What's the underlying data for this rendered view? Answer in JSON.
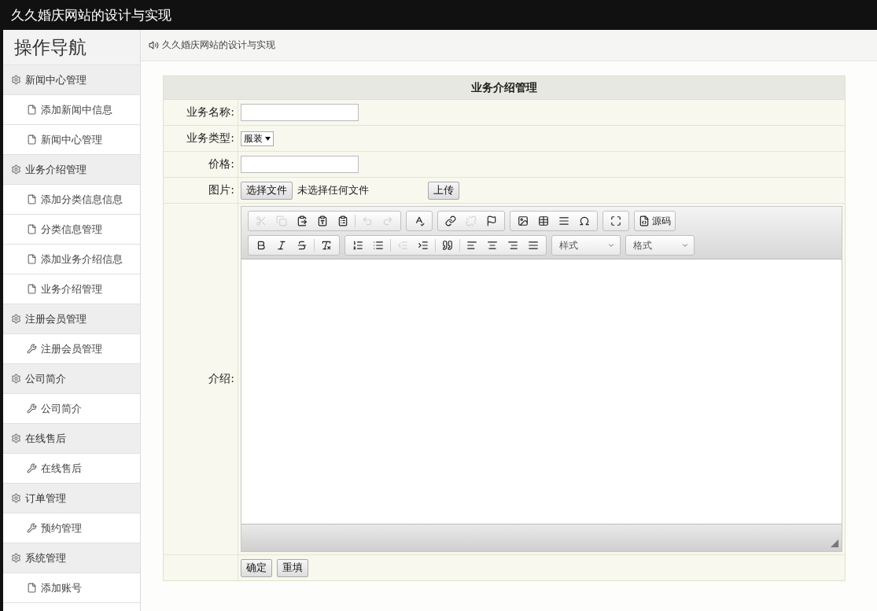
{
  "header": {
    "title": "久久婚庆网站的设计与实现"
  },
  "sidebar": {
    "title": "操作导航",
    "groups": [
      {
        "label": "新闻中心管理",
        "children": [
          {
            "label": "添加新闻中信息",
            "kind": "page"
          },
          {
            "label": "新闻中心管理",
            "kind": "page"
          }
        ]
      },
      {
        "label": "业务介绍管理",
        "children": [
          {
            "label": "添加分类信息信息",
            "kind": "page"
          },
          {
            "label": "分类信息管理",
            "kind": "page"
          },
          {
            "label": "添加业务介绍信息",
            "kind": "page"
          },
          {
            "label": "业务介绍管理",
            "kind": "page"
          }
        ]
      },
      {
        "label": "注册会员管理",
        "children": [
          {
            "label": "注册会员管理",
            "kind": "tool"
          }
        ]
      },
      {
        "label": "公司简介",
        "children": [
          {
            "label": "公司简介",
            "kind": "tool"
          }
        ]
      },
      {
        "label": "在线售后",
        "children": [
          {
            "label": "在线售后",
            "kind": "tool"
          }
        ]
      },
      {
        "label": "订单管理",
        "children": [
          {
            "label": "预约管理",
            "kind": "tool"
          }
        ]
      },
      {
        "label": "系统管理",
        "children": [
          {
            "label": "添加账号",
            "kind": "page"
          }
        ]
      }
    ]
  },
  "breadcrumb": {
    "text": "久久婚庆网站的设计与实现"
  },
  "form": {
    "title": "业务介绍管理",
    "fields": [
      {
        "kind": "text",
        "label": "业务名称:"
      },
      {
        "kind": "select",
        "label": "业务类型:",
        "value": "服装"
      },
      {
        "kind": "text",
        "label": "价格:"
      },
      {
        "kind": "file",
        "label": "图片:",
        "button": "选择文件",
        "status": "未选择任何文件",
        "upload": "上传"
      },
      {
        "kind": "editor",
        "label": "介绍:"
      }
    ],
    "toolbar_rows": [
      [
        {
          "kind": "group",
          "items": [
            {
              "kind": "icon",
              "disabled": true
            },
            {
              "kind": "icon",
              "disabled": true
            },
            {
              "kind": "icon",
              "disabled": false
            },
            {
              "kind": "icon",
              "disabled": false
            },
            {
              "kind": "icon",
              "disabled": false
            },
            {
              "kind": "separator"
            },
            {
              "kind": "icon",
              "disabled": true
            },
            {
              "kind": "icon",
              "disabled": true
            }
          ]
        },
        {
          "kind": "group",
          "items": [
            {
              "kind": "icon",
              "disabled": false
            }
          ]
        },
        {
          "kind": "group",
          "items": [
            {
              "kind": "icon",
              "disabled": false
            },
            {
              "kind": "icon",
              "disabled": true
            },
            {
              "kind": "icon",
              "disabled": false
            }
          ]
        },
        {
          "kind": "group",
          "items": [
            {
              "kind": "icon",
              "disabled": false
            },
            {
              "kind": "icon",
              "disabled": false
            },
            {
              "kind": "icon",
              "disabled": false
            },
            {
              "kind": "icon",
              "disabled": false
            }
          ]
        },
        {
          "kind": "group",
          "items": [
            {
              "kind": "icon",
              "disabled": false
            }
          ]
        },
        {
          "kind": "group",
          "items": [
            {
              "kind": "icon_label",
              "label": "源码",
              "disabled": false
            }
          ]
        }
      ],
      [
        {
          "kind": "group",
          "items": [
            {
              "kind": "icon",
              "disabled": false
            },
            {
              "kind": "icon",
              "disabled": false
            },
            {
              "kind": "icon",
              "disabled": false
            },
            {
              "kind": "separator"
            },
            {
              "kind": "icon",
              "disabled": false
            }
          ]
        },
        {
          "kind": "group",
          "items": [
            {
              "kind": "icon",
              "disabled": false
            },
            {
              "kind": "icon",
              "disabled": false
            },
            {
              "kind": "separator"
            },
            {
              "kind": "icon",
              "disabled": true
            },
            {
              "kind": "icon",
              "disabled": false
            },
            {
              "kind": "separator"
            },
            {
              "kind": "icon",
              "disabled": false
            },
            {
              "kind": "separator"
            },
            {
              "kind": "icon",
              "disabled": false
            },
            {
              "kind": "icon",
              "disabled": false
            },
            {
              "kind": "icon",
              "disabled": false
            },
            {
              "kind": "icon",
              "disabled": false
            }
          ]
        },
        {
          "kind": "combo",
          "label": "样式"
        },
        {
          "kind": "combo",
          "label": "格式"
        }
      ]
    ],
    "buttons": [
      "确定",
      "重填"
    ]
  }
}
